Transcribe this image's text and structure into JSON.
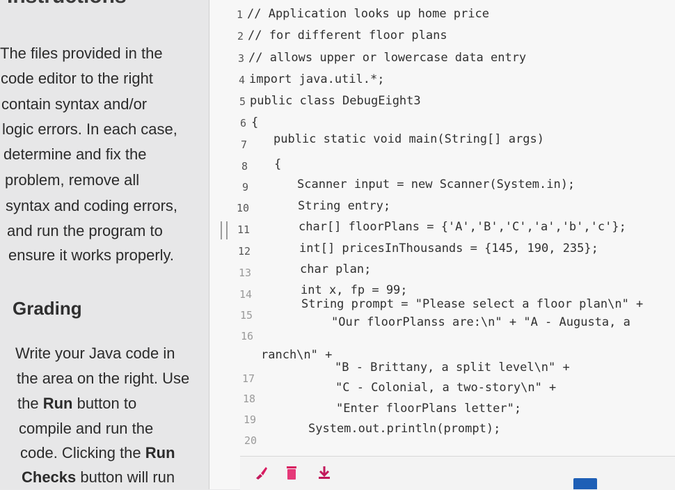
{
  "instructions": {
    "heading": "Instructions",
    "paragraph_lines": [
      "The files provided in the",
      "code editor to the right",
      "contain syntax and/or",
      "logic errors. In each case,",
      "determine and fix the",
      "problem, remove all",
      "syntax and coding errors,",
      "and run the program to",
      "ensure it works properly."
    ],
    "grading_heading": "Grading",
    "grading_lines": [
      {
        "before": "Write your Java code in",
        "bold": "",
        "after": ""
      },
      {
        "before": "the area on the right. Use",
        "bold": "",
        "after": ""
      },
      {
        "before": "the ",
        "bold": "Run",
        "after": " button to"
      },
      {
        "before": "compile and run the",
        "bold": "",
        "after": ""
      },
      {
        "before": "code. Clicking the ",
        "bold": "Run",
        "after": ""
      },
      {
        "before": "",
        "bold": "Checks",
        "after": " button will run"
      }
    ]
  },
  "editor": {
    "line_numbers": [
      "1",
      "2",
      "3",
      "4",
      "5",
      "6",
      "7",
      "8",
      "9",
      "10",
      "11",
      "12",
      "13",
      "14",
      "15",
      "16",
      "17",
      "18",
      "19",
      "20"
    ],
    "code_lines": [
      "// Application looks up home price",
      "// for different floor plans",
      "// allows upper or lowercase data entry",
      "import java.util.*;",
      "public class DebugEight3",
      "{",
      "public static void main(String[] args)",
      "{",
      "Scanner input = new Scanner(System.in);",
      "String entry;",
      "char[] floorPlans = {'A','B','C','a','b','c'};",
      "int[] pricesInThousands = {145, 190, 235};",
      "char plan;",
      "int x, fp = 99;",
      "String prompt = \"Please select a floor plan\\n\" +",
      "\"Our floorPlanss are:\\n\" + \"A - Augusta, a",
      "ranch\\n\" +",
      "\"B - Brittany, a split level\\n\" +",
      "\"C - Colonial, a two-story\\n\" +",
      "\"Enter floorPlans letter\";",
      "System.out.println(prompt);"
    ]
  },
  "toolbar": {
    "icons": [
      "brush-icon",
      "trash-icon",
      "download-icon"
    ]
  },
  "colors": {
    "panel_bg": "#e7e7e8",
    "editor_bg": "#f7f7f7",
    "icon_color": "#c2185b"
  }
}
